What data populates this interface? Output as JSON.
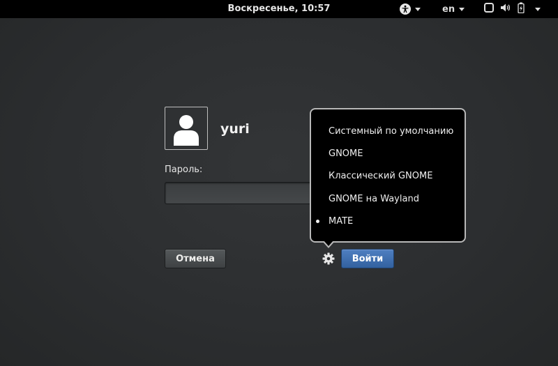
{
  "topbar": {
    "clock": "Воскресенье, 10:57",
    "language": "en",
    "icons": {
      "accessibility": "accessibility-icon",
      "display": "display-icon",
      "volume": "volume-icon",
      "battery": "battery-charging-icon"
    }
  },
  "user": {
    "name": "yuri",
    "avatar_icon": "user-avatar-icon"
  },
  "password": {
    "label": "Пароль:",
    "value": "",
    "placeholder": ""
  },
  "buttons": {
    "cancel": "Отмена",
    "login": "Войти",
    "session_icon": "gear-icon"
  },
  "session_menu": {
    "items": [
      {
        "label": "Системный по умолчанию",
        "selected": false
      },
      {
        "label": "GNOME",
        "selected": false
      },
      {
        "label": "Классический GNOME",
        "selected": false
      },
      {
        "label": "GNOME на Wayland",
        "selected": false
      },
      {
        "label": "MATE",
        "selected": true
      }
    ]
  },
  "colors": {
    "background": "#2c2e30",
    "topbar": "#000000",
    "login_button": "#3f6fb0",
    "popup_border": "#b9b9b9"
  }
}
